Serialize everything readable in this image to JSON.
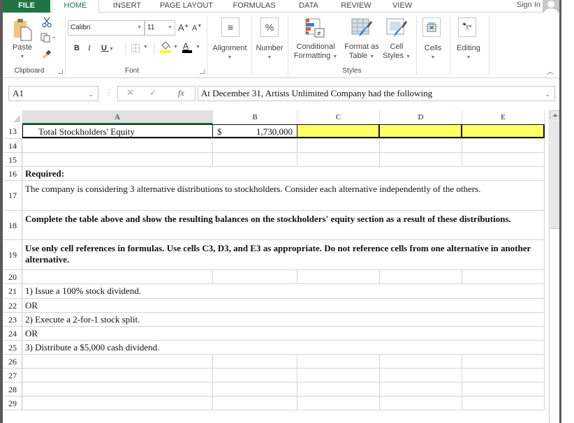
{
  "tabs": {
    "file": "FILE",
    "home": "HOME",
    "insert": "INSERT",
    "page_layout": "PAGE LAYOUT",
    "formulas": "FORMULAS",
    "data": "DATA",
    "review": "REVIEW",
    "view": "VIEW",
    "sign_in": "Sign In"
  },
  "ribbon": {
    "clipboard": {
      "paste": "Paste",
      "group": "Clipboard"
    },
    "font": {
      "name": "Calibri",
      "size": "11",
      "bold": "B",
      "italic": "I",
      "underline": "U",
      "group": "Font",
      "fill_color": "#ffff00",
      "font_color": "#000000"
    },
    "alignment": {
      "label": "Alignment"
    },
    "number": {
      "label": "Number",
      "symbol": "%"
    },
    "styles": {
      "conditional_1": "Conditional",
      "conditional_2": "Formatting",
      "format_table_1": "Format as",
      "format_table_2": "Table",
      "cell_styles_1": "Cell",
      "cell_styles_2": "Styles",
      "group": "Styles"
    },
    "cells": {
      "label": "Cells"
    },
    "editing": {
      "label": "Editing"
    }
  },
  "formula_bar": {
    "name_box": "A1",
    "fx": "fx",
    "content": "At December 31,  Artists Unlimited Company had the following"
  },
  "sheet": {
    "columns": [
      "A",
      "B",
      "C",
      "D",
      "E"
    ],
    "selected_column": "A",
    "highlight_color": "#ffff66",
    "rows": [
      {
        "num": "13",
        "a": "Total Stockholders' Equity",
        "b_currency": "$",
        "b_value": "1,730,000"
      },
      {
        "num": "14"
      },
      {
        "num": "15"
      },
      {
        "num": "16",
        "text": "Required:"
      },
      {
        "num": "17",
        "text": "The company is considering 3 alternative distributions to stockholders.  Consider each alternative independently of the others."
      },
      {
        "num": "18",
        "text": "Complete the table above and show the resulting balances on the stockholders' equity section as a result of these distributions."
      },
      {
        "num": "19",
        "text": "Use only cell references in formulas.  Use cells C3, D3, and E3 as appropriate.  Do not reference cells from one alternative in another alternative."
      },
      {
        "num": "20"
      },
      {
        "num": "21",
        "text": "1) Issue a 100% stock dividend."
      },
      {
        "num": "22",
        "text": "OR"
      },
      {
        "num": "23",
        "text": "2) Execute a 2-for-1 stock split."
      },
      {
        "num": "24",
        "text": "OR"
      },
      {
        "num": "25",
        "text": "3) Distribute a $5,000 cash dividend."
      },
      {
        "num": "26"
      },
      {
        "num": "27"
      },
      {
        "num": "28"
      },
      {
        "num": "29"
      }
    ]
  }
}
